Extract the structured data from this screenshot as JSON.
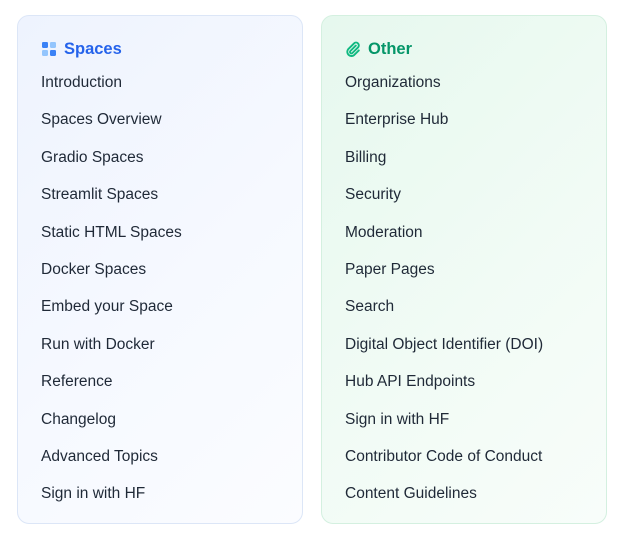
{
  "spaces": {
    "title": "Spaces",
    "icon": "spaces-grid-icon",
    "accent": "#2563eb",
    "items": [
      "Introduction",
      "Spaces Overview",
      "Gradio Spaces",
      "Streamlit Spaces",
      "Static HTML Spaces",
      "Docker Spaces",
      "Embed your Space",
      "Run with Docker",
      "Reference",
      "Changelog",
      "Advanced Topics",
      "Sign in with HF"
    ]
  },
  "other": {
    "title": "Other",
    "icon": "paperclip-icon",
    "accent": "#059669",
    "items": [
      "Organizations",
      "Enterprise Hub",
      "Billing",
      "Security",
      "Moderation",
      "Paper Pages",
      "Search",
      "Digital Object Identifier (DOI)",
      "Hub API Endpoints",
      "Sign in with HF",
      "Contributor Code of Conduct",
      "Content Guidelines"
    ]
  }
}
